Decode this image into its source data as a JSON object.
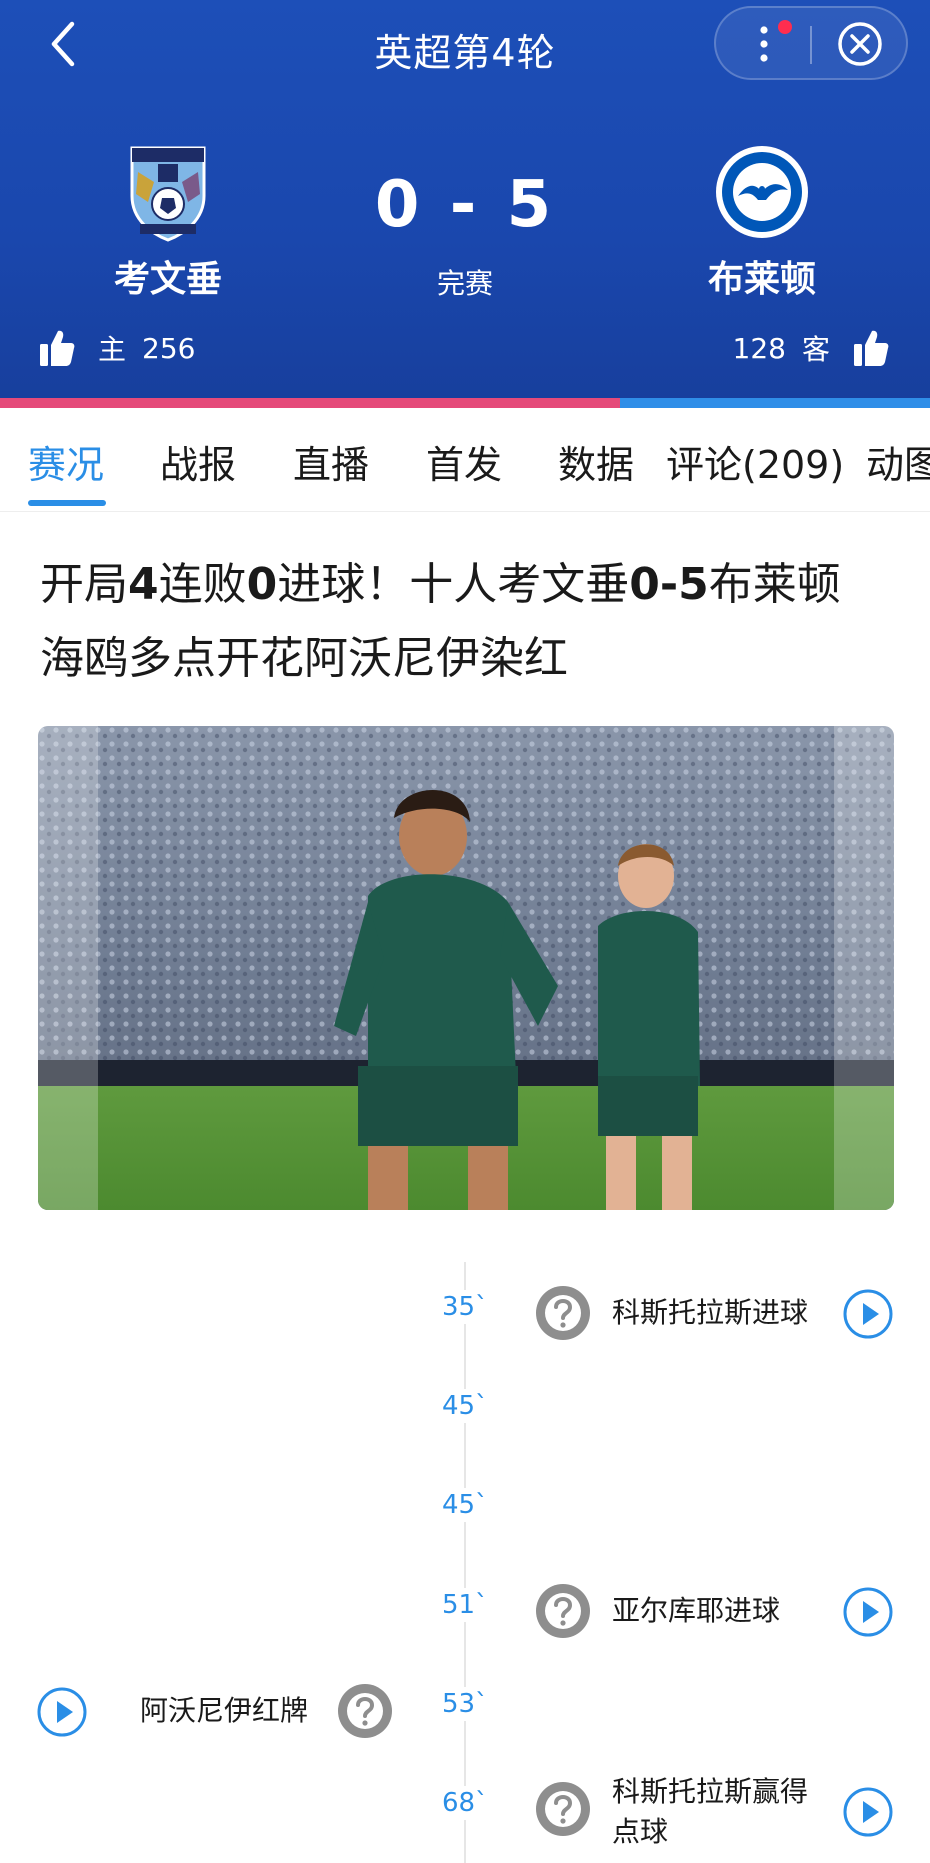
{
  "header": {
    "title": "英超第4轮",
    "home": {
      "name": "考文垂",
      "side_label": "主",
      "likes": "256"
    },
    "away": {
      "name": "布莱顿",
      "side_label": "客",
      "likes": "128"
    },
    "score": "0 - 5",
    "status": "完赛",
    "colors": {
      "background": "#1a47ad",
      "home_bar": "#e54a7a",
      "away_bar": "#2f8ee8",
      "notify_dot": "#ff2d4f"
    },
    "home_vote_share": 0.667
  },
  "tabs": [
    {
      "label": "赛况",
      "active": true
    },
    {
      "label": "战报",
      "active": false
    },
    {
      "label": "直播",
      "active": false
    },
    {
      "label": "首发",
      "active": false
    },
    {
      "label": "数据",
      "active": false
    },
    {
      "label": "评论(209)",
      "active": false
    },
    {
      "label": "动图",
      "active": false
    }
  ],
  "article": {
    "headline_parts": [
      "开局",
      "4",
      "连败",
      "0",
      "进球！十人考文垂",
      "0-5",
      "布莱顿 海鸥多点开花阿沃尼伊染红"
    ]
  },
  "timeline": {
    "accent": "#2a8ee6",
    "minutes": [
      "35`",
      "45`",
      "45`",
      "51`",
      "53`",
      "68`"
    ],
    "events": [
      {
        "minute": "35`",
        "side": "away",
        "text": "科斯托拉斯进球"
      },
      {
        "minute": "51`",
        "side": "away",
        "text": "亚尔库耶进球"
      },
      {
        "minute": "53`",
        "side": "home",
        "text": "阿沃尼伊红牌"
      },
      {
        "minute": "68`",
        "side": "away",
        "text_lines": [
          "科斯托拉斯赢得",
          "点球"
        ]
      }
    ]
  },
  "icons": [
    "back-arrow-icon",
    "more-dots-icon",
    "close-circle-icon",
    "coventry-crest-icon",
    "brighton-crest-icon",
    "thumbs-up-icon",
    "event-placeholder-icon",
    "play-video-icon"
  ]
}
